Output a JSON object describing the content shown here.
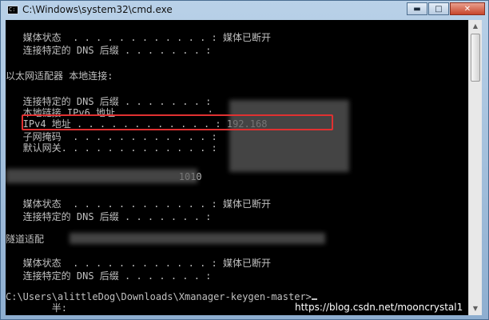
{
  "window": {
    "title": "C:\\Windows\\system32\\cmd.exe",
    "icon": "cmd-icon",
    "controls": {
      "minimize": "minimize-icon",
      "maximize": "maximize-icon",
      "close": "close-icon"
    }
  },
  "console": {
    "lines": [
      "   媒体状态  . . . . . . . . . . . . : 媒体已断开",
      "   连接特定的 DNS 后缀 . . . . . . . :",
      "",
      "以太网适配器 本地连接:",
      "",
      "   连接特定的 DNS 后缀 . . . . . . . :",
      "   本地链接 IPv6 地址. . . . . . . . :",
      "   IPv4 地址 . . . . . . . . . . . . : 192.168",
      "   子网掩码  . . . . . . . . . . . . :",
      "   默认网关. . . . . . . . . . . . . :",
      "",
      "                              1010",
      "",
      "   媒体状态  . . . . . . . . . . . . : 媒体已断开",
      "   连接特定的 DNS 后缀 . . . . . . . :",
      "",
      "隧道适配",
      "",
      "   媒体状态  . . . . . . . . . . . . : 媒体已断开",
      "   连接特定的 DNS 后缀 . . . . . . . :",
      "",
      "C:\\Users\\alittleDog\\Downloads\\Xmanager-keygen-master>",
      "        半:"
    ]
  },
  "colors": {
    "console_text": "#c0c0c0",
    "highlight_border": "#e03131"
  },
  "watermark": "https://blog.csdn.net/mooncrystal1"
}
